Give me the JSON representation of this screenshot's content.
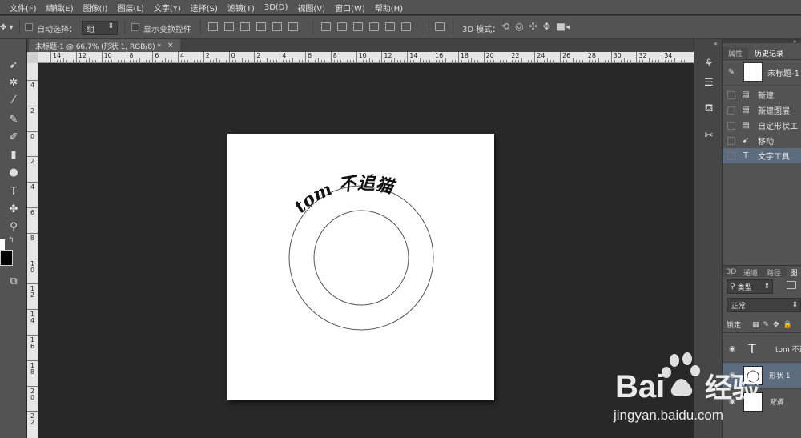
{
  "menu": [
    "文件(F)",
    "编辑(E)",
    "图像(I)",
    "图层(L)",
    "文字(Y)",
    "选择(S)",
    "滤镜(T)",
    "3D(D)",
    "视图(V)",
    "窗口(W)",
    "帮助(H)"
  ],
  "options": {
    "auto_select_label": "自动选择：",
    "auto_select_value": "组",
    "show_transform_label": "显示变换控件",
    "mode_3d_label": "3D 模式："
  },
  "document": {
    "tab_title": "未标题-1 @ 66.7% (形状 1, RGB/8) *",
    "tab_close": "×",
    "ruler_h_labels": [
      "14",
      "12",
      "10",
      "8",
      "6",
      "4",
      "2",
      "0",
      "2",
      "4",
      "6",
      "8",
      "10",
      "12",
      "14",
      "16",
      "18",
      "20",
      "22",
      "24",
      "26",
      "28",
      "30",
      "32",
      "34"
    ],
    "ruler_v_labels": [
      "4",
      "2",
      "0",
      "2",
      "4",
      "6",
      "8",
      "1 0",
      "1 2",
      "1 4",
      "1 6",
      "1 8",
      "2 0",
      "2 2"
    ],
    "arc_text": "tom 不追猫"
  },
  "history": {
    "tab_properties": "属性",
    "tab_history": "历史记录",
    "snapshot_name": "未标题-1",
    "items": [
      {
        "label": "新建",
        "icon": "document-icon"
      },
      {
        "label": "新建图层",
        "icon": "document-icon"
      },
      {
        "label": "自定形状工",
        "icon": "document-icon"
      },
      {
        "label": "移动",
        "icon": "move-icon"
      },
      {
        "label": "文字工具",
        "icon": "type-icon"
      }
    ]
  },
  "layers": {
    "tabs": [
      "3D",
      "通道",
      "路径"
    ],
    "filter_label": "类型",
    "blend_mode": "正常",
    "lock_label": "锁定：",
    "rows": [
      {
        "name": "tom 不追",
        "kind": "text"
      },
      {
        "name": "形状 1",
        "kind": "shape"
      },
      {
        "name": "背景",
        "kind": "background"
      }
    ]
  },
  "watermark": {
    "brand": "Bai",
    "brand2": "经验",
    "url": "jingyan.baidu.com"
  },
  "colors": {
    "ui_bg": "#535353",
    "canvas_bg": "#282828",
    "selected_row": "#5c6b7d",
    "document": "#ffffff"
  }
}
